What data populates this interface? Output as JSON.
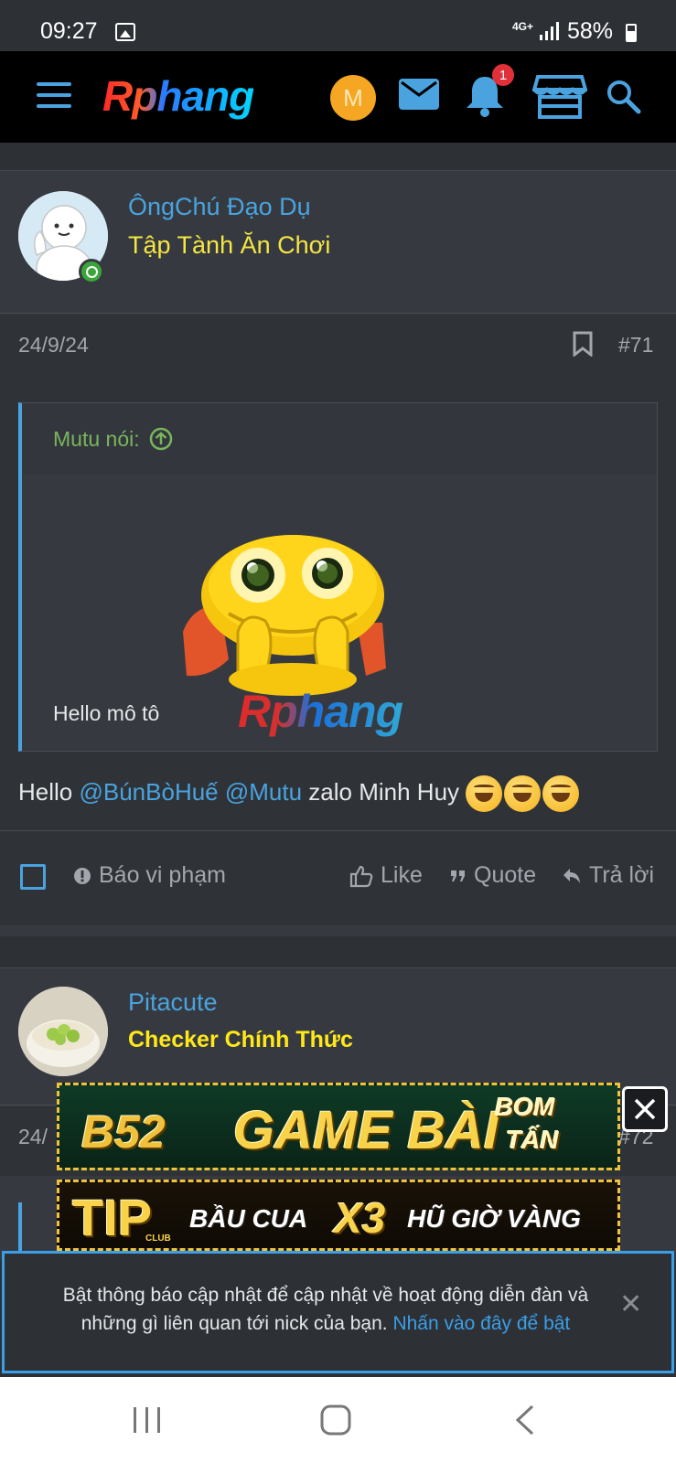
{
  "status_bar": {
    "time": "09:27",
    "network": "4G+",
    "battery": "58%"
  },
  "header": {
    "logo": "Rphang",
    "avatar_letter": "M",
    "notifications_count": "1",
    "icons": [
      "menu-icon",
      "mail-icon",
      "bell-icon",
      "store-icon",
      "search-icon"
    ]
  },
  "posts": [
    {
      "author": "ÔngChú Đạo Dụ",
      "user_title": "Tập Tành Ăn Chơi",
      "date": "24/9/24",
      "number": "#71",
      "quote": {
        "author_label": "Mutu nói:",
        "text": "Hello mô tô",
        "watermark": "Rphang"
      },
      "body": {
        "prefix": "Hello ",
        "mention1": "@BúnBòHuế",
        "space": " ",
        "mention2": "@Mutu",
        "suffix": " zalo Minh Huy"
      },
      "actions": {
        "report": "Báo vi phạm",
        "like": "Like",
        "quote": "Quote",
        "reply": "Trả lời"
      }
    },
    {
      "author": "Pitacute",
      "user_title": "Checker Chính Thức",
      "date": "24/",
      "number": "#72"
    }
  ],
  "ads": {
    "ad1_brand": "B52",
    "ad1_main": "GAME BÀI",
    "ad1_side1": "BOM",
    "ad1_side2": "TẤN",
    "ad2_brand": "TIP",
    "ad2_sub": "CLUB",
    "ad2_text1": "BẦU CUA",
    "ad2_text2": "X3",
    "ad2_text3": "HŨ GIỜ VÀNG"
  },
  "notice": {
    "text": "Bật thông báo cập nhật để cập nhật về hoạt động diễn đàn và những gì liên quan tới nick của bạn.",
    "link": "Nhấn vào đây để bật"
  },
  "colors": {
    "accent": "#4aa3df",
    "user_title": "#f5e642",
    "background": "#2d3136",
    "badge": "#e0313a"
  }
}
